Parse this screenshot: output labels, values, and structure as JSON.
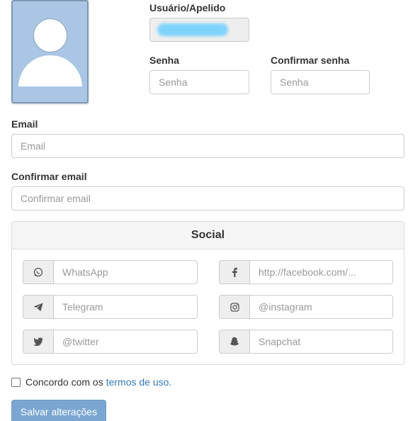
{
  "profile": {
    "avatar_icon": "user-silhouette-icon"
  },
  "username": {
    "label": "Usuário/Apelido"
  },
  "password": {
    "label": "Senha",
    "placeholder": "Senha"
  },
  "confirm_password": {
    "label": "Confirmar senha",
    "placeholder": "Senha"
  },
  "email": {
    "label": "Email",
    "placeholder": "Email"
  },
  "confirm_email": {
    "label": "Confirmar email",
    "placeholder": "Confirmar email"
  },
  "social": {
    "title": "Social",
    "fields": [
      {
        "icon": "whatsapp-icon",
        "placeholder": "WhatsApp"
      },
      {
        "icon": "facebook-icon",
        "placeholder": "http://facebook.com/..."
      },
      {
        "icon": "telegram-icon",
        "placeholder": "Telegram"
      },
      {
        "icon": "instagram-icon",
        "placeholder": "@instagram"
      },
      {
        "icon": "twitter-icon",
        "placeholder": "@twitter"
      },
      {
        "icon": "snapchat-icon",
        "placeholder": "Snapchat"
      }
    ]
  },
  "terms": {
    "text": "Concordo com os",
    "link": "termos de uso."
  },
  "submit": {
    "label": "Salvar alterações"
  },
  "colors": {
    "avatar_bg": "#aac6e4",
    "button_bg": "#7aa6d1",
    "link": "#337ab7",
    "redaction": "#7fd3fb"
  }
}
